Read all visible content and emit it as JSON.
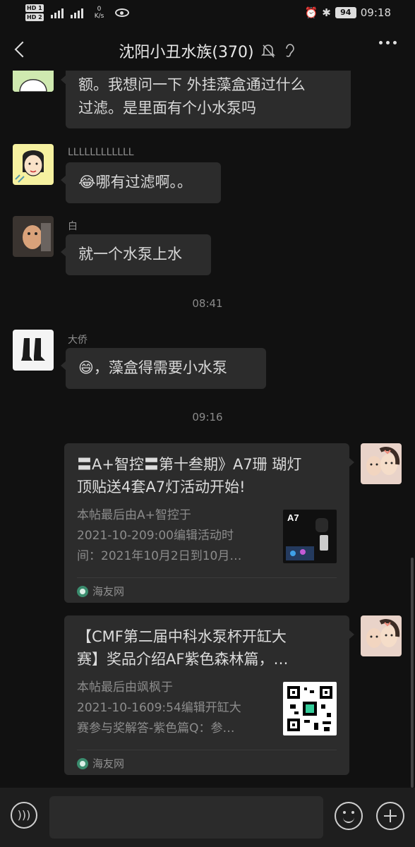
{
  "status_bar": {
    "hd1": "HD 1",
    "hd2": "HD 2",
    "net_speed_value": "0",
    "net_speed_unit": "K/s",
    "battery": "94",
    "time": "09:18"
  },
  "header": {
    "title": "沈阳小丑水族(370)"
  },
  "messages": [
    {
      "type": "text",
      "sender": "",
      "text_lines": [
        "额。我想问一下 外挂藻盒通过什么",
        "过滤。是里面有个小水泵吗"
      ]
    },
    {
      "type": "text",
      "sender": "LLLLLLLLLLLL",
      "emoji": "😂",
      "text": "哪有过滤啊。。"
    },
    {
      "type": "text",
      "sender": "白",
      "text": "就一个水泵上水"
    },
    {
      "type": "time",
      "text": "08:41"
    },
    {
      "type": "text",
      "sender": "大侨",
      "emoji": "😄",
      "text": "，藻盒得需要小水泵"
    },
    {
      "type": "time",
      "text": "09:16"
    },
    {
      "type": "card",
      "title_lines": [
        "〓A+智控〓第十叁期》A7珊 瑚灯",
        "顶贴送4套A7灯活动开始!"
      ],
      "desc_lines": [
        "本帖最后由A+智控于",
        "2021-10-209:00编辑活动时",
        "间：2021年10月2日到10月…"
      ],
      "thumb_label": "A7",
      "source": "海友网"
    },
    {
      "type": "card",
      "title_lines": [
        "【CMF第二届中科水泵杯开缸大",
        "赛】奖品介绍AF紫色森林篇，…"
      ],
      "desc_lines": [
        "本帖最后由飒枫于",
        "2021-10-1609:54编辑开缸大",
        "赛参与奖解答-紫色篇Q：参…"
      ],
      "source": "海友网"
    }
  ],
  "input_bar": {
    "placeholder": ""
  }
}
